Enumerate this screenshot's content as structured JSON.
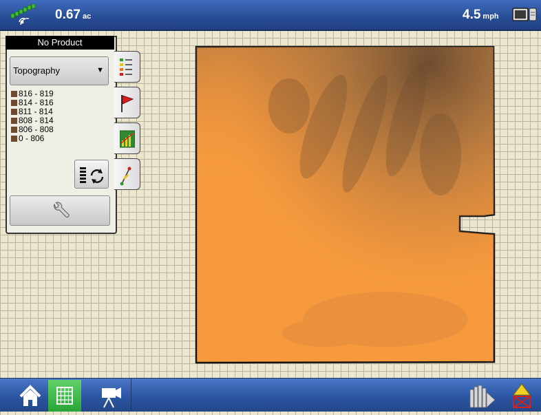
{
  "top_bar": {
    "area_value": "0.67",
    "area_unit": "ac",
    "speed_value": "4.5",
    "speed_unit": "mph",
    "gps_icon": "gps-satellite-icon",
    "screen_icon": "display-screen-icon"
  },
  "map_panel": {
    "product_label": "No Product",
    "layer_select": {
      "selected": "Topography"
    },
    "legend": [
      {
        "label": "816 - 819"
      },
      {
        "label": "814 - 816"
      },
      {
        "label": "811 - 814"
      },
      {
        "label": "808 - 814"
      },
      {
        "label": "806 - 808"
      },
      {
        "label": "0 - 806"
      }
    ],
    "legend_swatch_color": "#6e4a2e"
  },
  "side_tabs": [
    "legend-tab",
    "flag-tab",
    "chart-tab",
    "guidance-tab"
  ],
  "bottom_bar": {
    "buttons": [
      "home-icon",
      "map-grid-icon",
      "camera-icon",
      "section-control-icon",
      "warning-icon"
    ],
    "active": "map-grid-icon"
  },
  "colors": {
    "field_fill": "#f79a3e",
    "field_dark": "#6a4a30",
    "accent_green": "#27a535",
    "bar_blue": "#2c56a3"
  }
}
